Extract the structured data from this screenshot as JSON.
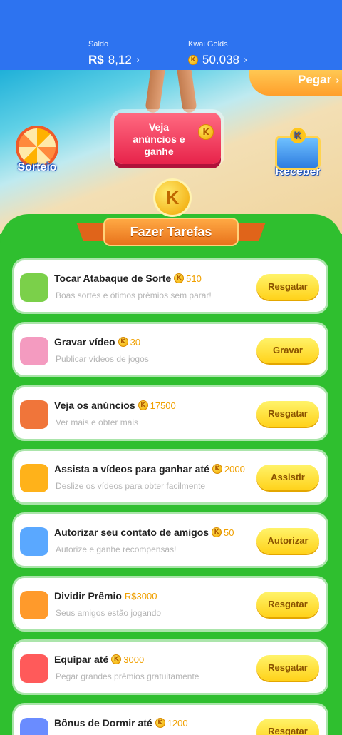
{
  "header": {
    "balance_label": "Saldo",
    "balance_currency": "R$",
    "balance_value": "8,12",
    "golds_label": "Kwai Golds",
    "golds_value": "50.038"
  },
  "scene": {
    "ads_button_label": "Veja anúncios e ganhe",
    "pegar_label": "Pegar",
    "sorteio_label": "Sorteio",
    "receber_label": "Receber"
  },
  "tasks_banner": {
    "title": "Fazer Tarefas",
    "coin_letter": "K"
  },
  "tasks": [
    {
      "title": "Tocar Atabaque de Sorte",
      "reward": "510",
      "reward_coin": true,
      "subtitle": "Boas sortes e ótimos prêmios sem parar!",
      "action": "Resgatar",
      "icon_color": "#7bd04a"
    },
    {
      "title": "Gravar vídeo",
      "reward": "30",
      "reward_coin": true,
      "subtitle": "Publicar vídeos de jogos",
      "action": "Gravar",
      "icon_color": "#f49bc0"
    },
    {
      "title": "Veja os anúncios",
      "reward": "17500",
      "reward_coin": true,
      "subtitle": "Ver mais e obter mais",
      "action": "Resgatar",
      "icon_color": "#f0753a"
    },
    {
      "title": "Assista a vídeos para ganhar até",
      "reward": "2000",
      "reward_coin": true,
      "subtitle": "Deslize os vídeos para obter facilmente",
      "action": "Assistir",
      "icon_color": "#ffb21a"
    },
    {
      "title": "Autorizar seu contato de amigos",
      "reward": "50",
      "reward_coin": true,
      "subtitle": "Autorize e ganhe recompensas!",
      "action": "Autorizar",
      "icon_color": "#5aa8ff"
    },
    {
      "title": "Dividir Prêmio",
      "reward": "R$3000",
      "reward_coin": false,
      "subtitle": "Seus amigos estão jogando",
      "action": "Resgatar",
      "icon_color": "#ff9a2b"
    },
    {
      "title": "Equipar até",
      "reward": "3000",
      "reward_coin": true,
      "subtitle": "Pegar grandes prêmios gratuitamente",
      "action": "Resgatar",
      "icon_color": "#ff5a5a"
    },
    {
      "title": "Bônus de Dormir até",
      "reward": "1200",
      "reward_coin": true,
      "subtitle": "",
      "action": "Resgatar",
      "icon_color": "#6a8cff"
    }
  ]
}
